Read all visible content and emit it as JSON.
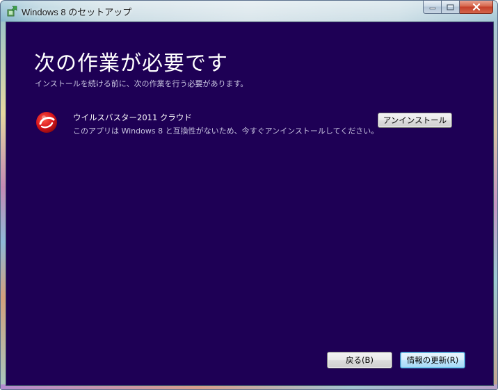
{
  "window": {
    "title": "Windows 8 のセットアップ"
  },
  "page": {
    "heading": "次の作業が必要です",
    "subheading": "インストールを続ける前に、次の作業を行う必要があります。"
  },
  "items": [
    {
      "name": "ウイルスバスター2011 クラウド",
      "description": "このアプリは Windows 8 と互換性がないため、今すぐアンインストールしてください。",
      "action_label": "アンインストール",
      "icon": "trend-micro-icon"
    }
  ],
  "footer": {
    "back_label": "戻る(B)",
    "refresh_label": "情報の更新(R)"
  },
  "colors": {
    "content_background": "#1e0055",
    "heading": "#ffffff",
    "secondary_text": "#c8c4e0",
    "icon_red": "#d7141a"
  }
}
